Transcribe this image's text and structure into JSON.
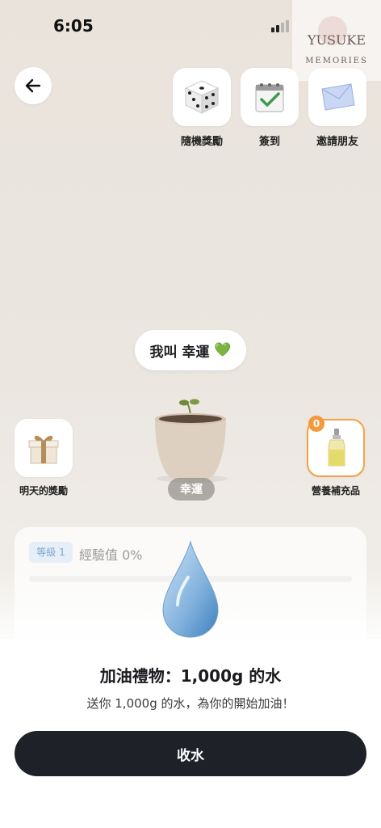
{
  "status_bar": {
    "time": "6:05"
  },
  "watermark": {
    "title": "YUSUKE",
    "subtitle": "MEMORIES",
    "signature": "ㄥㄖ"
  },
  "top_actions": [
    {
      "label": "隨機獎勵",
      "icon": "dice-icon"
    },
    {
      "label": "簽到",
      "icon": "calendar-check-icon"
    },
    {
      "label": "邀請朋友",
      "icon": "envelope-icon"
    }
  ],
  "plant": {
    "speech": "我叫 幸運",
    "speech_emoji": "💚",
    "name": "幸運"
  },
  "side_items": {
    "left": {
      "label": "明天的獎勵",
      "icon": "gift-box-icon"
    },
    "right": {
      "label": "營養補充品",
      "icon": "nutrient-bottle-icon",
      "count": "0",
      "accent": "#f0a24a"
    }
  },
  "level": {
    "tag": "等級 1",
    "exp_text": "經驗值 0%",
    "exp_fraction": 0
  },
  "reward_sheet": {
    "title": "加油禮物：1,000g 的水",
    "description": "送你 1,000g 的水，為你的開始加油！",
    "button_label": "收水"
  },
  "colors": {
    "background": "#ebe6e0",
    "button": "#1f2129",
    "badge": "#f29a3c",
    "level_tag_text": "#7fa6cf"
  }
}
